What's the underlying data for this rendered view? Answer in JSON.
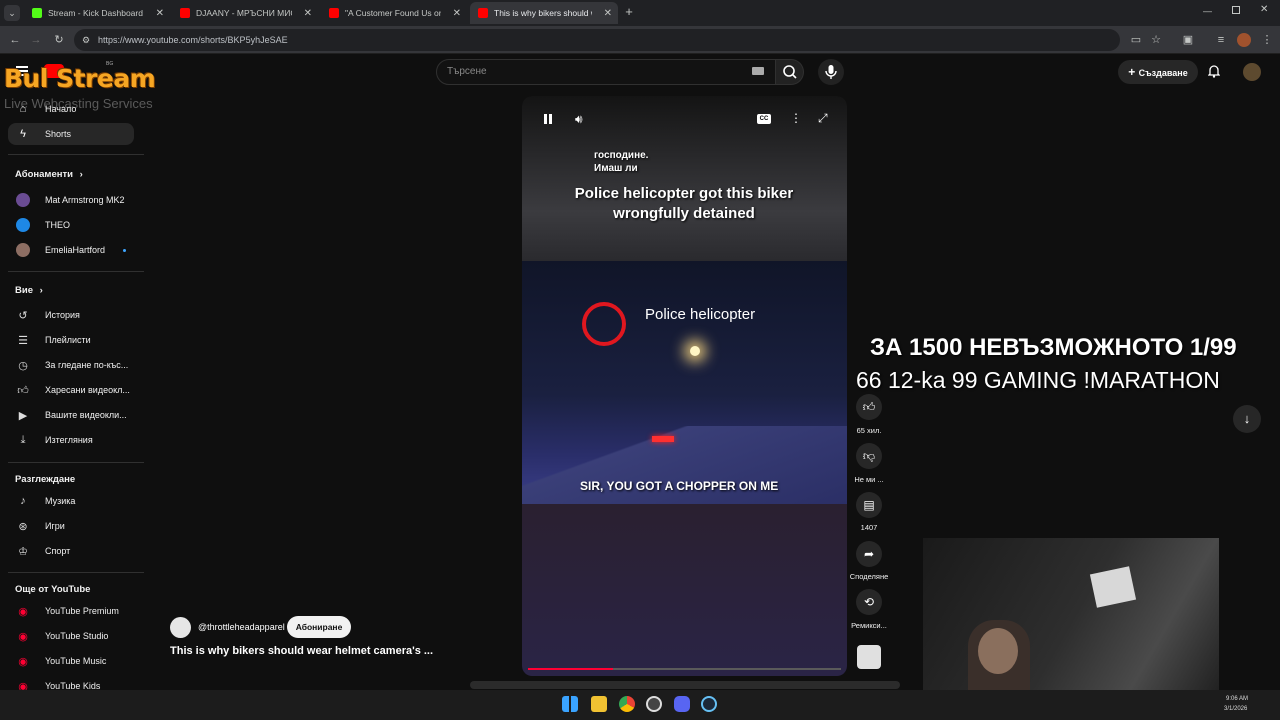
{
  "browser": {
    "tabs": [
      {
        "label": "Stream - Kick Dashboard",
        "fav_color": "#53fc18"
      },
      {
        "label": "DJAANY - МРЪСНИ МИСЛИ (L",
        "fav_color": "#ff0000"
      },
      {
        "label": "\"A Customer Found Us on Yelp",
        "fav_color": "#ff0000"
      },
      {
        "label": "This is why bikers should w",
        "fav_color": "#ff0000"
      }
    ],
    "url": "https://www.youtube.com/shorts/BKP5yhJeSAE"
  },
  "overlay": {
    "logo_text": "Bul Stream",
    "logo_sub": "Live Webcasting Services",
    "ticker_line1": "ЗА 1500 НЕВЪЗМОЖНОТО 1/99",
    "ticker_line2": "66 12-ka 99 GAMING !MARATHON"
  },
  "masthead": {
    "logo_badge": "BG",
    "search_placeholder": "Търсене",
    "create_label": "Създаване"
  },
  "sidebar": {
    "main": [
      {
        "label": "Начало",
        "icon": "home-icon"
      },
      {
        "label": "Shorts",
        "icon": "shorts-icon"
      }
    ],
    "subs_header": "Абонаменти",
    "subs": [
      {
        "label": "Mat Armstrong MK2",
        "color": "#6a4c93"
      },
      {
        "label": "THEO",
        "color": "#1e88e5"
      },
      {
        "label": "EmeliaHartford",
        "color": "#8d6e63"
      }
    ],
    "you_header": "Вие",
    "you": [
      {
        "label": "История",
        "icon": "history-icon"
      },
      {
        "label": "Плейлисти",
        "icon": "playlist-icon"
      },
      {
        "label": "За гледане по-къс...",
        "icon": "clock-icon"
      },
      {
        "label": "Харесани видеокл...",
        "icon": "thumbs-up-icon"
      },
      {
        "label": "Вашите видеокли...",
        "icon": "your-videos-icon"
      },
      {
        "label": "Изтегляния",
        "icon": "download-icon"
      }
    ],
    "explore_header": "Разглеждане",
    "explore": [
      {
        "label": "Музика",
        "icon": "music-icon"
      },
      {
        "label": "Игри",
        "icon": "gaming-icon"
      },
      {
        "label": "Спорт",
        "icon": "trophy-icon"
      }
    ],
    "more_header": "Още от YouTube",
    "more": [
      {
        "label": "YouTube Premium"
      },
      {
        "label": "YouTube Studio"
      },
      {
        "label": "YouTube Music"
      },
      {
        "label": "YouTube Kids"
      }
    ]
  },
  "video": {
    "caption_top": "господине.",
    "caption_top2": "Имаш ли",
    "headline": "Police helicopter got this biker wrongfully detained",
    "tag_label": "Police helicopter",
    "subtitle": "SIR, YOU GOT A CHOPPER ON ME",
    "channel": "@throttleheadapparel",
    "subscribe_label": "Абониране",
    "title": "This is why bikers should wear helmet camera's ...",
    "progress": 0.27
  },
  "actions": {
    "like_count": "65 хил.",
    "dislike_label": "Не ми ...",
    "comments_count": "1407",
    "share_label": "Споделяне",
    "remix_label": "Ремикси..."
  },
  "taskbar": {
    "time": "9:06 AM",
    "date": "3/1/2026"
  }
}
